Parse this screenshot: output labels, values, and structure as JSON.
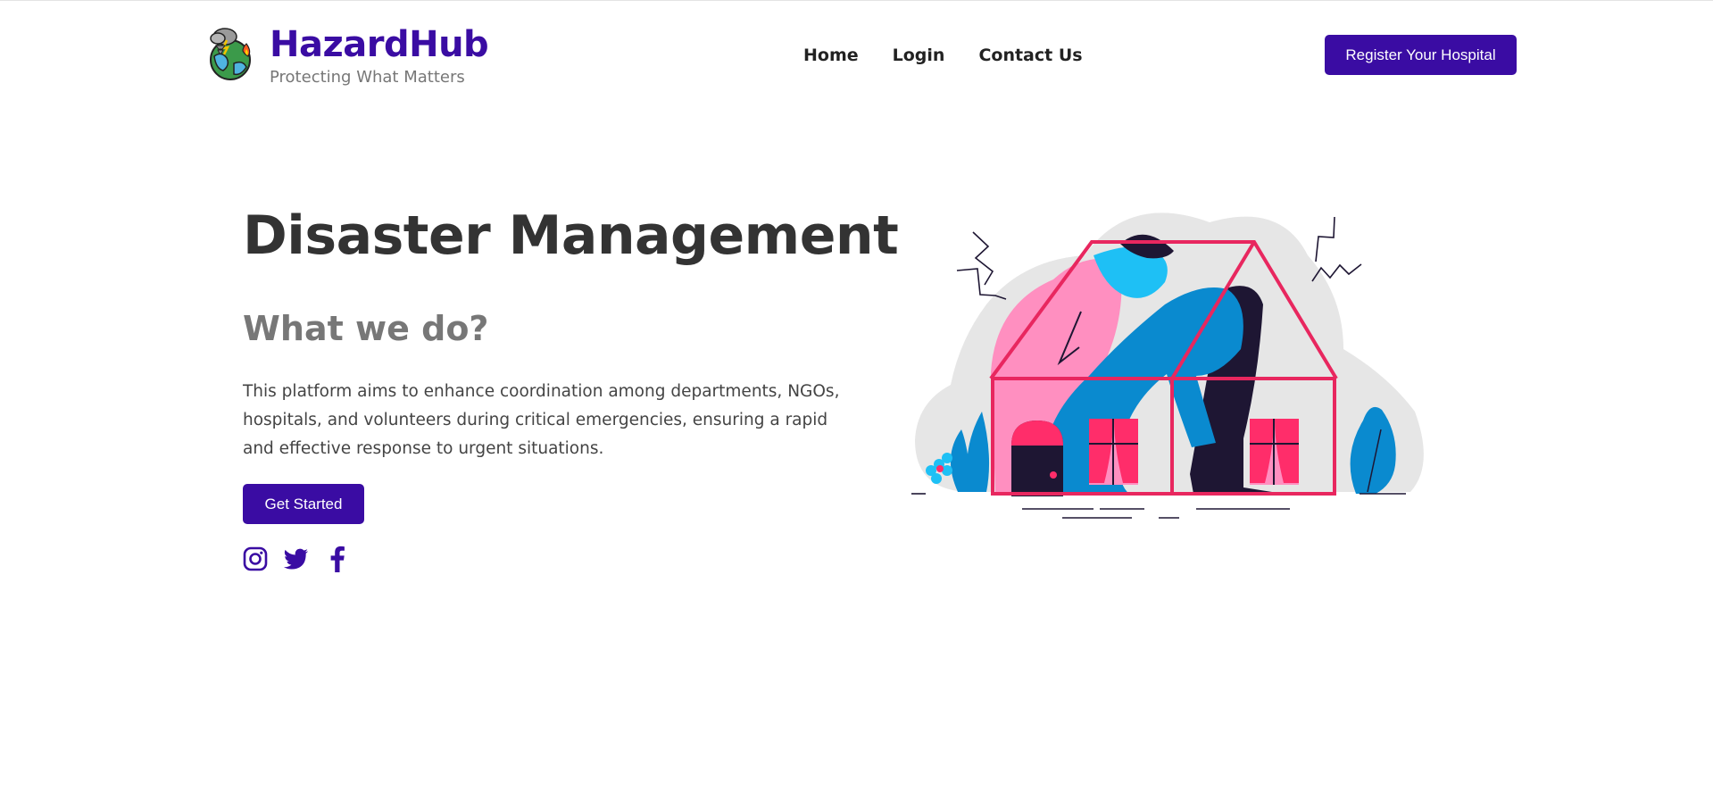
{
  "header": {
    "brand": {
      "title": "HazardHub",
      "tagline": "Protecting What Matters",
      "logo_icon": "hazard-globe-icon"
    },
    "nav": [
      {
        "label": "Home"
      },
      {
        "label": "Login"
      },
      {
        "label": "Contact Us"
      }
    ],
    "register_label": "Register Your Hospital"
  },
  "hero": {
    "title": "Disaster Management",
    "subtitle": "What we do?",
    "description": "This platform aims to enhance coordination among departments, NGOs, hospitals, and volunteers during critical emergencies, ensuring a rapid and effective response to urgent situations.",
    "cta_label": "Get Started",
    "socials": [
      {
        "icon": "instagram-icon"
      },
      {
        "icon": "twitter-icon"
      },
      {
        "icon": "facebook-icon"
      }
    ],
    "illustration_icon": "person-in-house-illustration"
  },
  "colors": {
    "brand": "#3a0ca3",
    "text_dark": "#333333",
    "text_muted": "#777777",
    "house_outline": "#e8275f",
    "pink": "#ff8fc0",
    "blue": "#0a8acf",
    "navy": "#1e1633"
  }
}
